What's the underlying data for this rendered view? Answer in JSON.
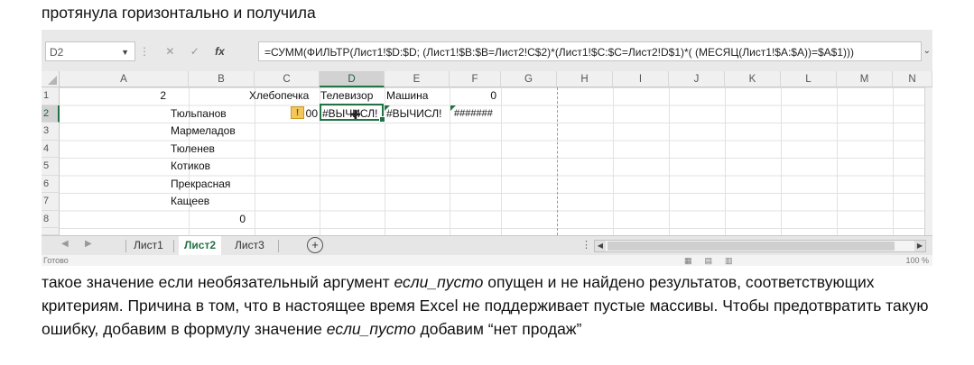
{
  "doc": {
    "top_line": "протянула горизонтально и получила",
    "para": {
      "p1": "такое значение если необязательный аргумент ",
      "em1": "если_пусто",
      "p2": " опущен и не найдено результатов, соответствующих критериям. Причина в том, что в настоящее время Excel не поддерживает пустые массивы. Чтобы предотвратить такую ошибку, добавим в формулу значение ",
      "em2": "если_пусто",
      "p3": " добавим “нет продаж”"
    }
  },
  "excel": {
    "namebox": "D2",
    "formula": "=СУММ(ФИЛЬТР(Лист1!$D:$D; (Лист1!$B:$B=Лист2!C$2)*(Лист1!$C:$C=Лист2!D$1)*( (МЕСЯЦ(Лист1!$A:$A))=$A$1)))",
    "columns": [
      "A",
      "B",
      "C",
      "D",
      "E",
      "F",
      "G",
      "H",
      "I",
      "J",
      "K",
      "L",
      "M",
      "N"
    ],
    "rows": [
      "1",
      "2",
      "3",
      "4",
      "5",
      "6",
      "7",
      "8"
    ],
    "cells": {
      "A1": "2",
      "C1": "Хлебопечка",
      "D1": "Телевизор",
      "E1": "Машина",
      "F1": "0",
      "B2": "Тюльпанов",
      "C2": "00",
      "D2": "#ВЫЧИСЛ!",
      "E2": "#ВЫЧИСЛ!",
      "F2": "#######",
      "B3": "Мармеладов",
      "B4": "Тюленев",
      "B5": "Котиков",
      "B6": "Прекрасная",
      "B7": "Кащеев",
      "B8": "0"
    },
    "sheets": [
      "Лист1",
      "Лист2",
      "Лист3"
    ],
    "active_sheet": "Лист2",
    "status_left": "Готово",
    "zoom": "100 %",
    "accent": "#217346"
  }
}
